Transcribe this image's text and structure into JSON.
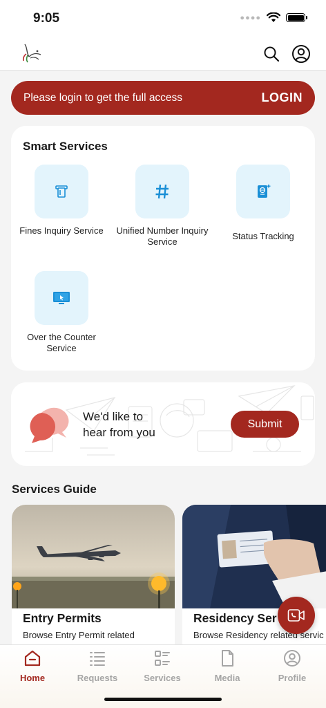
{
  "status_bar": {
    "time": "9:05",
    "icons": [
      "signal-dots-icon",
      "wifi-icon",
      "battery-icon"
    ]
  },
  "header": {
    "logo": "falcon-logo",
    "icons": [
      "search-icon",
      "profile-icon"
    ]
  },
  "login_banner": {
    "message": "Please login to get the full access",
    "button_label": "LOGIN"
  },
  "smart_services": {
    "title": "Smart Services",
    "items": [
      {
        "label": "Fines Inquiry Service",
        "icon": "fines-card-icon"
      },
      {
        "label": "Unified Number Inquiry Service",
        "icon": "hash-icon"
      },
      {
        "label": "Status Tracking",
        "icon": "passport-icon"
      },
      {
        "label": "Over the Counter Service",
        "icon": "monitor-icon"
      }
    ]
  },
  "feedback": {
    "line1": "We'd like to",
    "line2": "hear from you",
    "submit_label": "Submit"
  },
  "services_guide": {
    "title": "Services Guide",
    "cards": [
      {
        "title": "Entry Permits",
        "description": "Browse Entry Permit related",
        "image": "airplane-landing"
      },
      {
        "title": "Residency Ser",
        "description": "Browse Residency related servic",
        "image": "emirates-id-card"
      }
    ]
  },
  "fab": {
    "icon": "video-call-icon"
  },
  "bottom_nav": {
    "active": "Home",
    "items": [
      {
        "label": "Home",
        "icon": "home-icon"
      },
      {
        "label": "Requests",
        "icon": "list-icon"
      },
      {
        "label": "Services",
        "icon": "services-grid-icon"
      },
      {
        "label": "Media",
        "icon": "document-icon"
      },
      {
        "label": "Profile",
        "icon": "profile-icon"
      }
    ]
  },
  "colors": {
    "brand": "#a3281f",
    "tile_background": "#e3f4fc",
    "tile_icon": "#1a8fd6",
    "inactive": "#a5a5a5"
  }
}
